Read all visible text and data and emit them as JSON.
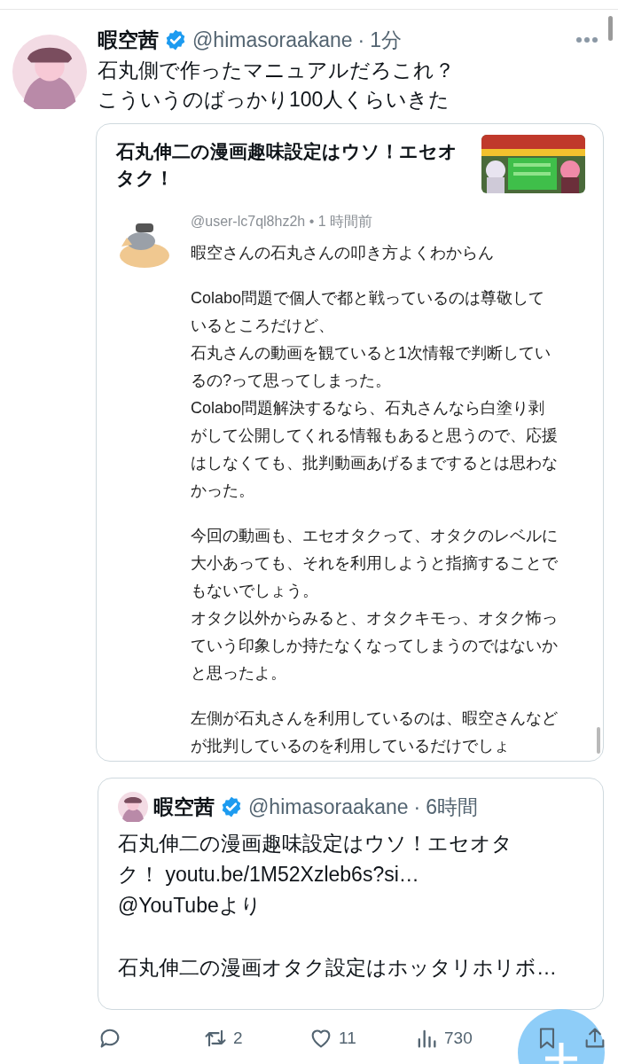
{
  "tweet": {
    "author": {
      "name": "暇空茜",
      "verified": true,
      "handle": "@himasoraakane",
      "separator": "·",
      "time": "1分"
    },
    "text_lines": [
      "石丸側で作ったマニュアルだろこれ？",
      "こういうのばっかり100人くらいきた"
    ],
    "link_card": {
      "title": "石丸伸二の漫画趣味設定はウソ！エセオタク！",
      "comment": {
        "handle": "@user-lc7ql8hz2h",
        "separator": "•",
        "time": "1 時間前",
        "paragraphs": [
          [
            "暇空さんの石丸さんの叩き方よくわからん"
          ],
          [
            "Colabo問題で個人で都と戦っているのは尊敬して",
            "いるところだけど、",
            "石丸さんの動画を観ていると1次情報で判断してい",
            "るの?って思ってしまった。",
            "Colabo問題解決するなら、石丸さんなら白塗り剥",
            "がして公開してくれる情報もあると思うので、応援",
            "はしなくても、批判動画あげるまでするとは思わな",
            "かった。"
          ],
          [
            "今回の動画も、エセオタクって、オタクのレベルに",
            "大小あっても、それを利用しようと指摘することで",
            "もないでしょう。",
            "オタク以外からみると、オタクキモっ、オタク怖っ",
            "ていう印象しか持たなくなってしまうのではないか",
            "と思ったよ。"
          ],
          [
            "左側が石丸さんを利用しているのは、暇空さんなど",
            "が批判しているのを利用しているだけでしょ"
          ]
        ]
      }
    },
    "quoted_tweet": {
      "author": {
        "name": "暇空茜",
        "verified": true,
        "handle": "@himasoraakane",
        "separator": "·",
        "time": "6時間"
      },
      "paragraphs": [
        [
          "石丸伸二の漫画趣味設定はウソ！エセオタ",
          "ク！ youtu.be/1M52Xzleb6s?si…",
          "@YouTubeより"
        ],
        [
          "石丸伸二の漫画オタク設定はホッタリホリボ…"
        ]
      ]
    },
    "actions": [
      {
        "kind": "reply"
      },
      {
        "kind": "retweet",
        "count": "2"
      },
      {
        "kind": "like",
        "count": "11"
      },
      {
        "kind": "views",
        "count": "730"
      },
      {
        "kind": "bookmark"
      },
      {
        "kind": "share"
      }
    ]
  }
}
